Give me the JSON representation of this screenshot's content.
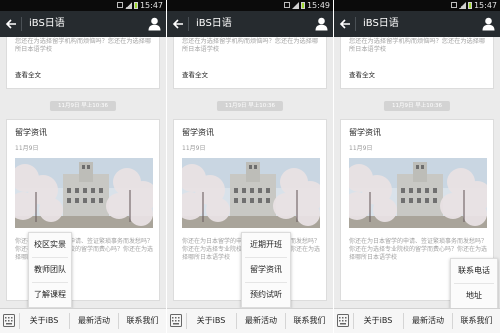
{
  "panels": [
    {
      "status_time": "15:47",
      "app_title": "iBS日语",
      "top_card": {
        "snippet": "您还在为选择留学机构而烦恼吗？您还在为选择哪所日本语学校",
        "more": "查看全文"
      },
      "date_pill": "11月9日 早上10:36",
      "article": {
        "title": "留学资讯",
        "date": "11月9日",
        "desc": "你还在为日本留学的申请、签证繁琐事务而发愁吗？你还在为选择专业院校的留学而费心吗？你还在为选择哪所日本语学校"
      },
      "popup": [
        "校区实景",
        "教师团队",
        "了解课程"
      ],
      "tabs": [
        "关于iBS",
        "最新活动",
        "联系我们"
      ]
    },
    {
      "status_time": "15:49",
      "app_title": "iBS日语",
      "top_card": {
        "snippet": "您还在为选择留学机构而烦恼吗？您还在为选择哪所日本语学校",
        "more": "查看全文"
      },
      "date_pill": "11月9日 早上10:36",
      "article": {
        "title": "留学资讯",
        "date": "11月9日",
        "desc": "你还在为日本留学的申请、签证繁琐事务而发愁吗？你还在为选择专业院校的留学而费心吗？你还在为选择哪所日本语学校"
      },
      "popup": [
        "近期开班",
        "留学资讯",
        "预约试听"
      ],
      "tabs": [
        "关于iBS",
        "最新活动",
        "联系我们"
      ]
    },
    {
      "status_time": "15:47",
      "app_title": "iBS日语",
      "top_card": {
        "snippet": "您还在为选择留学机构而烦恼吗？您还在为选择哪所日本语学校",
        "more": "查看全文"
      },
      "date_pill": "11月9日 早上10:36",
      "article": {
        "title": "留学资讯",
        "date": "11月9日",
        "desc": "你还在为日本留学的申请、签证繁琐事务而发愁吗？你还在为选择专业院校的留学而费心吗？你还在为选择哪所日本语学校"
      },
      "popup": [
        "联系电话",
        "地址"
      ],
      "tabs": [
        "关于iBS",
        "最新活动",
        "联系我们"
      ]
    }
  ],
  "icons": [
    "back-arrow-icon",
    "person-icon",
    "keyboard-icon"
  ],
  "colors": {
    "titlebar": "#262b2f",
    "background": "#ebebeb",
    "battery": "#9cd62d"
  }
}
